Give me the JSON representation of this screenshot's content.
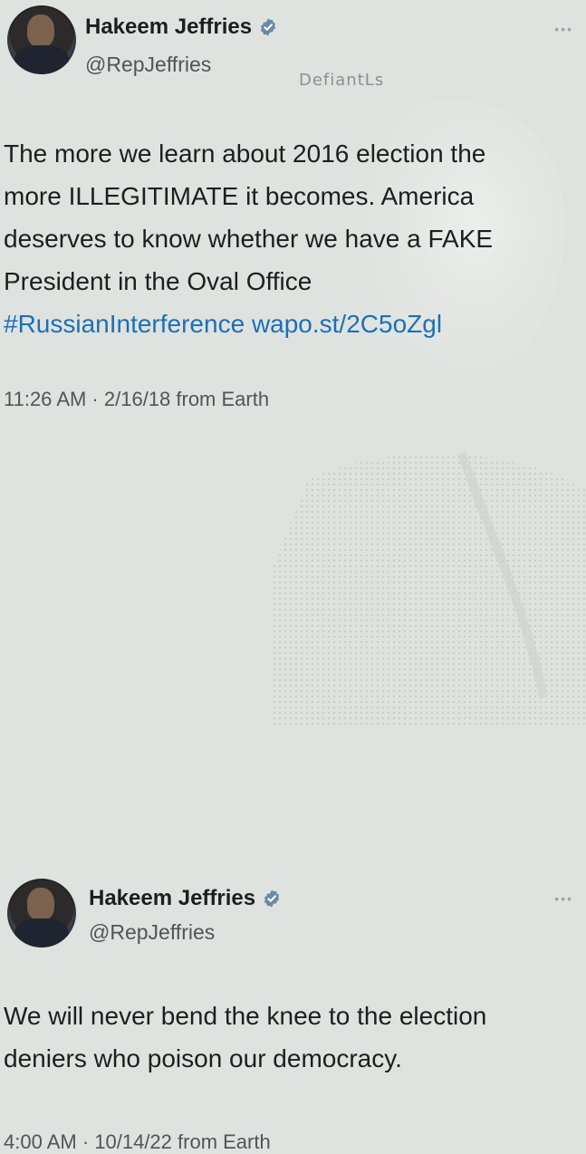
{
  "watermark": "DefiantLs",
  "tweets": [
    {
      "name": "Hakeem Jeffries",
      "handle": "@RepJeffries",
      "more": "•••",
      "lines": [
        "The more we learn about 2016 election the",
        "more ILLEGITIMATE it becomes. America",
        "deserves to know whether we have a FAKE",
        "President in the Oval Office"
      ],
      "hashtag": "#RussianInterference",
      "link": "wapo.st/2C5oZgl",
      "meta": "11:26 AM · 2/16/18 from Earth"
    },
    {
      "name": "Hakeem Jeffries",
      "handle": "@RepJeffries",
      "more": "•••",
      "lines": [
        "We will never bend the knee to the election",
        "deniers who poison our democracy."
      ],
      "meta": "4:00 AM · 10/14/22 from Earth"
    }
  ],
  "colors": {
    "link": "#1d6fb8",
    "verified": "#6b8aa8",
    "background": "#dfe3df"
  },
  "icons": {
    "verified": "verified-badge-icon",
    "more": "more-options-icon"
  }
}
